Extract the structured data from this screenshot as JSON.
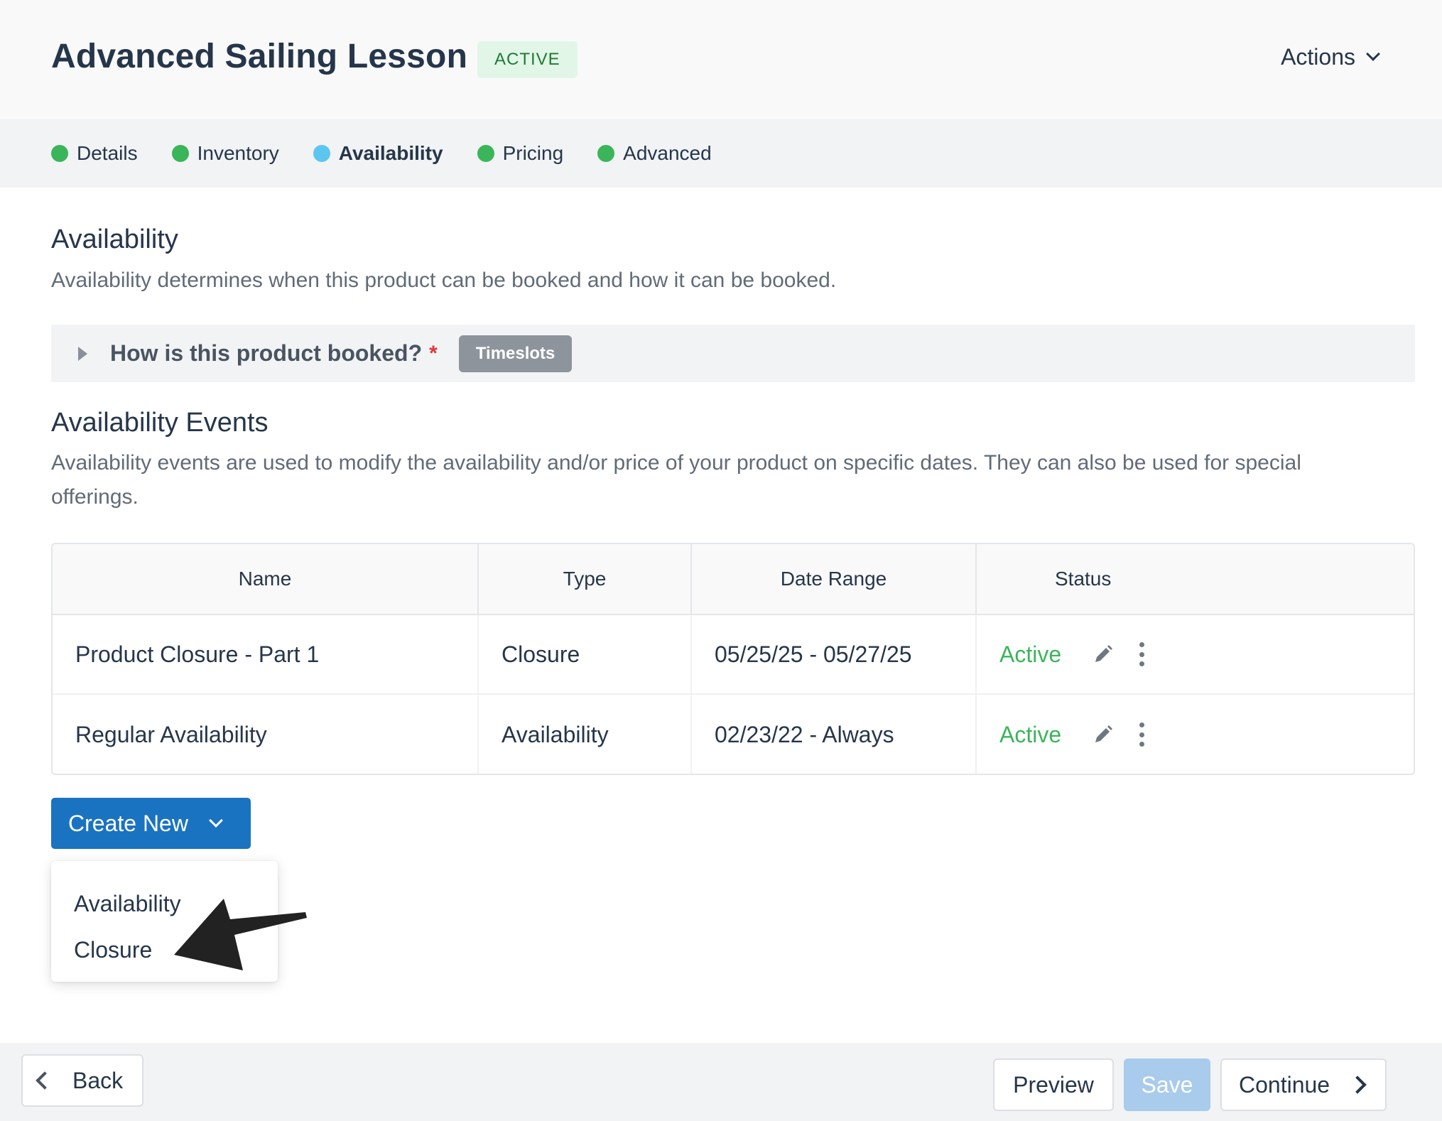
{
  "header": {
    "title": "Advanced Sailing Lesson",
    "status": "ACTIVE",
    "actions_label": "Actions"
  },
  "steps": [
    {
      "label": "Details",
      "state": "complete"
    },
    {
      "label": "Inventory",
      "state": "complete"
    },
    {
      "label": "Availability",
      "state": "current"
    },
    {
      "label": "Pricing",
      "state": "complete"
    },
    {
      "label": "Advanced",
      "state": "complete"
    }
  ],
  "availability": {
    "heading": "Availability",
    "description": "Availability determines when this product can be booked and how it can be booked.",
    "booked_question": "How is this product booked?",
    "required_mark": "*",
    "booking_type": "Timeslots"
  },
  "events": {
    "heading": "Availability Events",
    "description": "Availability events are used to modify the availability and/or price of your product on specific dates. They can also be used for special offerings.",
    "columns": [
      "Name",
      "Type",
      "Date Range",
      "Status"
    ],
    "rows": [
      {
        "name": "Product Closure - Part 1",
        "type": "Closure",
        "date_range": "05/25/25 - 05/27/25",
        "status": "Active"
      },
      {
        "name": "Regular Availability",
        "type": "Availability",
        "date_range": "02/23/22 - Always",
        "status": "Active"
      }
    ]
  },
  "create_new": {
    "label": "Create New",
    "menu": [
      "Availability",
      "Closure"
    ]
  },
  "footer": {
    "back": "Back",
    "preview": "Preview",
    "save": "Save",
    "continue": "Continue"
  },
  "colors": {
    "primary": "#1a73c0",
    "complete": "#3bb55a",
    "current": "#5cc6f0",
    "status_active_bg": "#e2f6e7",
    "save_disabled": "#a9cbec"
  },
  "icons": [
    "chevron-down-icon",
    "caret-right-icon",
    "pencil-icon",
    "kebab-menu-icon",
    "chevron-left-icon",
    "chevron-right-icon",
    "annotation-arrow"
  ]
}
